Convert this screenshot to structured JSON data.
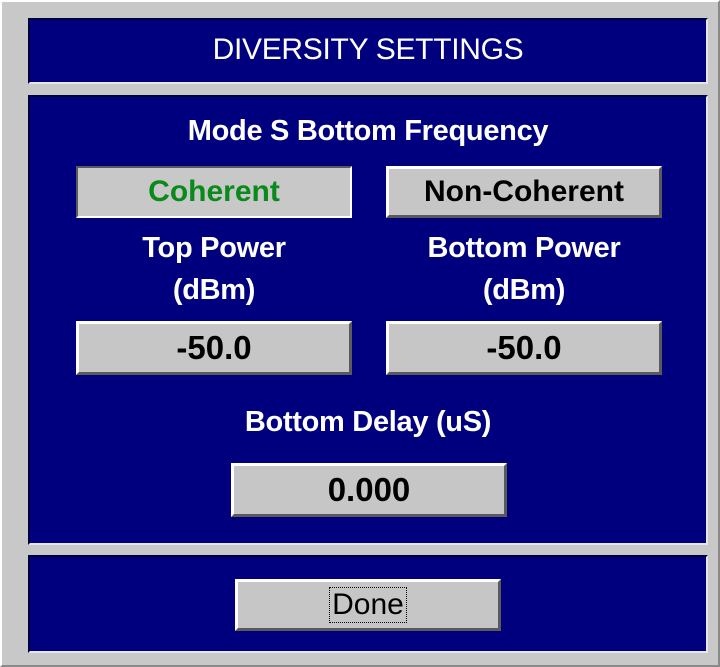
{
  "window": {
    "title": "DIVERSITY SETTINGS"
  },
  "mode": {
    "label": "Mode S Bottom Frequency",
    "selected": "Coherent",
    "options": [
      "Coherent",
      "Non-Coherent"
    ],
    "selected_color": "#0a8a1a"
  },
  "power": {
    "top_label": "Top Power\n(dBm)",
    "top_value": "-50.0",
    "bottom_label": "Bottom Power\n(dBm)",
    "bottom_value": "-50.0"
  },
  "delay": {
    "label": "Bottom Delay (uS)",
    "value": "0.000"
  },
  "footer": {
    "done_label": "Done"
  },
  "colors": {
    "panel_background": "#00007f",
    "dialog_background": "#c8c8c8",
    "text_on_panel": "#ffffff"
  }
}
